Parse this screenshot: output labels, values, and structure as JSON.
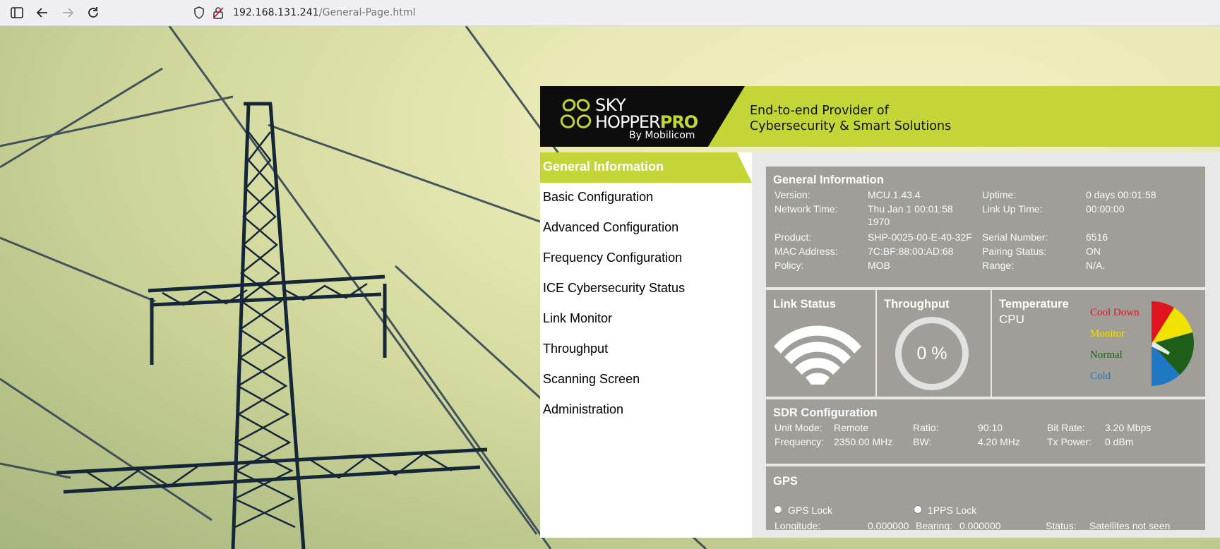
{
  "browser": {
    "url_host": "192.168.131.241",
    "url_path": "/General-Page.html"
  },
  "header": {
    "logo_sky": "SKY",
    "logo_hopper": "HOPPER",
    "logo_pro": "PRO",
    "logo_by": "By Mobilicom",
    "tagline_line1": "End-to-end Provider of",
    "tagline_line2": "Cybersecurity & Smart Solutions"
  },
  "sidebar": {
    "items": [
      {
        "label": "General Information",
        "active": true
      },
      {
        "label": "Basic Configuration"
      },
      {
        "label": "Advanced Configuration"
      },
      {
        "label": "Frequency Configuration"
      },
      {
        "label": "ICE Cybersecurity Status"
      },
      {
        "label": "Link Monitor"
      },
      {
        "label": "Throughput"
      },
      {
        "label": "Scanning Screen"
      },
      {
        "label": "Administration"
      }
    ]
  },
  "general": {
    "title": "General Information",
    "version_label": "Version:",
    "version": "MCU.1.43.4",
    "uptime_label": "Uptime:",
    "uptime": "0 days 00:01:58",
    "network_time_label": "Network Time:",
    "network_time_1": "Thu Jan 1 00:01:58",
    "network_time_2": "1970",
    "link_up_label": "Link Up Time:",
    "link_up": "00:00:00",
    "product_label": "Product:",
    "product": "SHP-0025-00-E-40-32F",
    "serial_label": "Serial Number:",
    "serial": "6516",
    "mac_label": "MAC Address:",
    "mac": "7C:BF:88:00:AD:68",
    "pairing_label": "Pairing Status:",
    "pairing": "ON",
    "policy_label": "Policy:",
    "policy": "MOB",
    "range_label": "Range:",
    "range": "N/A."
  },
  "link_status": {
    "title": "Link Status",
    "icon": "wifi-icon"
  },
  "throughput": {
    "title": "Throughput",
    "value": "0 %"
  },
  "temperature": {
    "title": "Temperature",
    "subtitle": "CPU",
    "legend": [
      {
        "label": "Cool Down",
        "color": "#e0141e"
      },
      {
        "label": "Monitor",
        "color": "#f2e200"
      },
      {
        "label": "Normal",
        "color": "#1d5f18"
      },
      {
        "label": "Cold",
        "color": "#1f78c4"
      }
    ]
  },
  "sdr": {
    "title": "SDR Configuration",
    "unit_mode_label": "Unit Mode:",
    "unit_mode": "Remote",
    "ratio_label": "Ratio:",
    "ratio": "90:10",
    "bitrate_label": "Bit Rate:",
    "bitrate": "3.20 Mbps",
    "freq_label": "Frequency:",
    "freq": "2350.00 MHz",
    "bw_label": "BW:",
    "bw": "4.20 MHz",
    "txpower_label": "Tx Power:",
    "txpower": "0 dBm"
  },
  "gps": {
    "title": "GPS",
    "gps_lock_label": "GPS Lock",
    "pps_lock_label": "1PPS Lock",
    "longitude_label": "Longitude:",
    "longitude": "0.000000",
    "bearing_label": "Bearing:",
    "bearing": "0.000000",
    "status_label": "Status:",
    "status": "Satellites not seen"
  }
}
